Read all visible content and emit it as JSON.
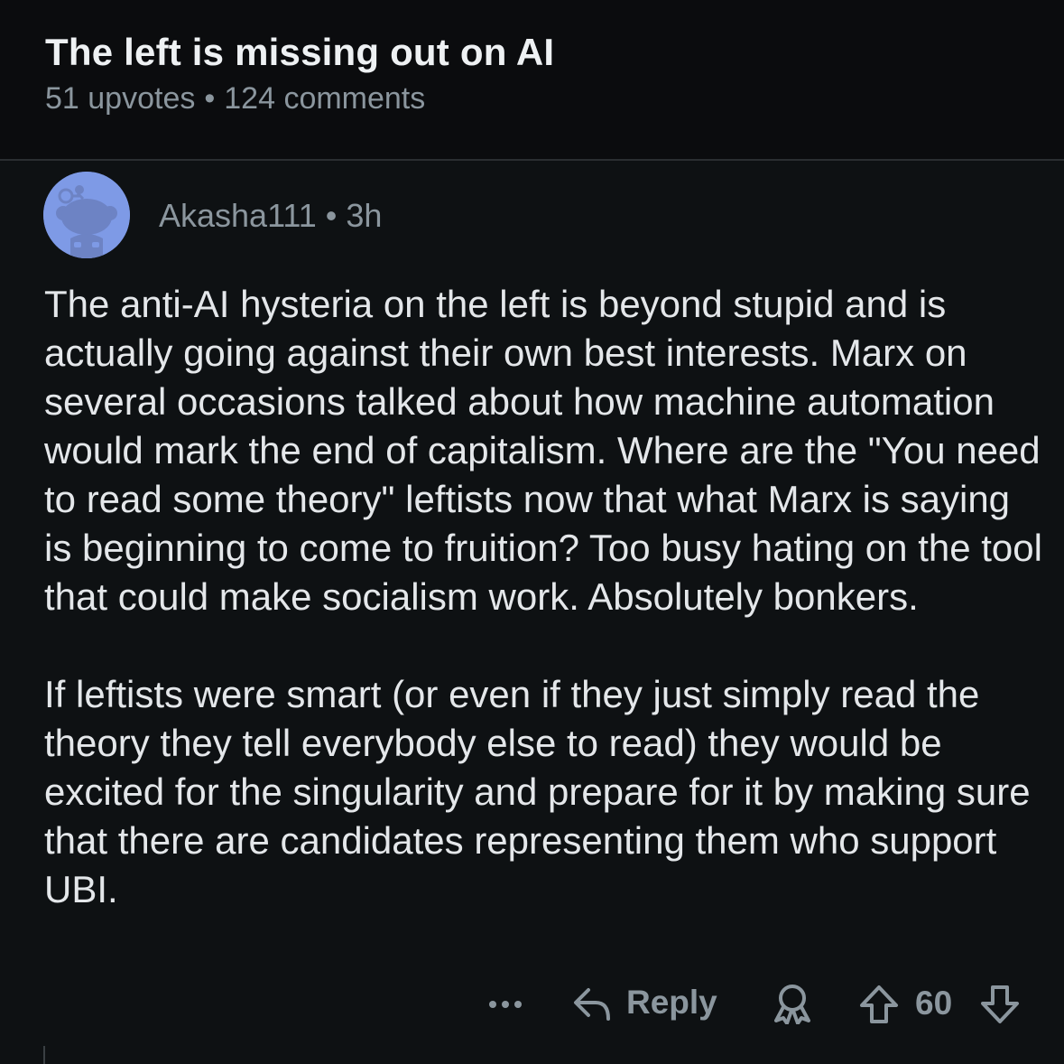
{
  "post": {
    "title": "The left is missing out on AI",
    "upvotes": "51 upvotes",
    "separator": "•",
    "comments": "124 comments"
  },
  "comment": {
    "author": "Akasha111",
    "separator": "•",
    "age": "3h",
    "paragraphs": [
      "The anti-AI hysteria on the left is beyond stupid and is actually going against their own best interests. Marx on several occasions talked about how machine automation would mark the end of capitalism. Where are the \"You need to read some theory\" leftists now that what Marx is saying is beginning to come to fruition? Too busy hating on the tool that could make socialism work. Absolutely bonkers.",
      "If leftists were smart (or even if they just simply read the theory they tell everybody else to read) they would be excited for the singularity and prepare for it by making sure that there are candidates representing them who support UBI."
    ],
    "actions": {
      "more_icon": "more-horizontal-icon",
      "reply_icon": "reply-arrow-icon",
      "reply_label": "Reply",
      "award_icon": "award-icon",
      "upvote_icon": "upvote-arrow-icon",
      "score": "60",
      "downvote_icon": "downvote-arrow-icon"
    }
  },
  "colors": {
    "background": "#0e1113",
    "header_background": "#0b0c0e",
    "avatar": "#7e9ae6",
    "muted_text": "#8b969e",
    "body_text": "#e4e7ea"
  }
}
